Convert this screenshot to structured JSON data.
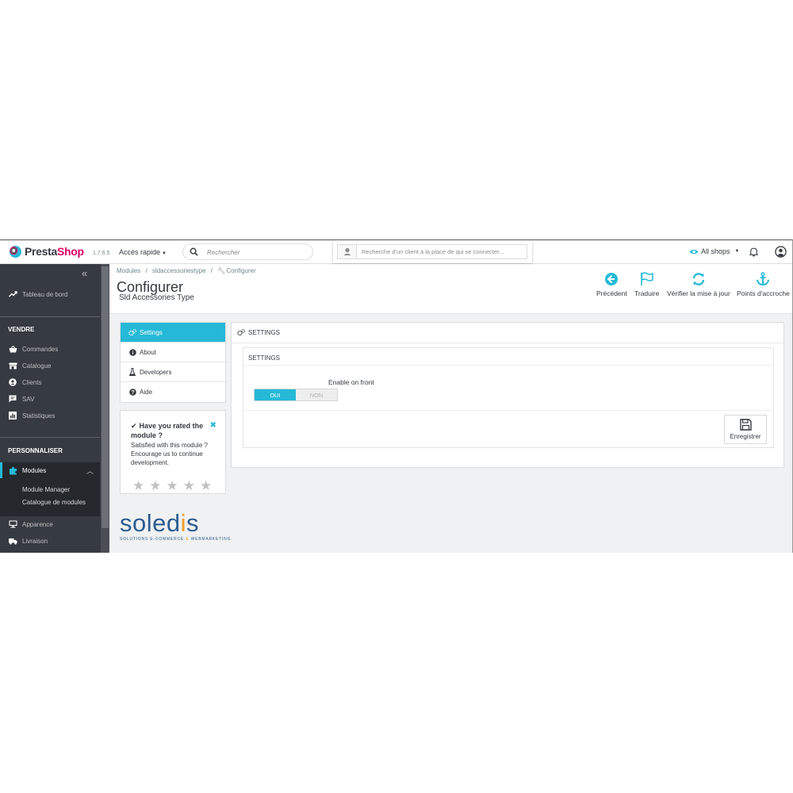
{
  "header": {
    "brand_name": "Presta",
    "brand_name_accent": "Shop",
    "version": "1.7.6.5",
    "quick_access": "Accès rapide",
    "search_placeholder": "Rechercher",
    "customer_placeholder": "Recherche d'un client à la place de qui se connecter...",
    "shops": "All shops"
  },
  "sidebar": {
    "collapse": "«",
    "dashboard": "Tableau de bord",
    "section_sell": "VENDRE",
    "sell_items": [
      "Commandes",
      "Catalogue",
      "Clients",
      "SAV",
      "Statistiques"
    ],
    "section_customize": "PERSONNALISER",
    "modules": "Modules",
    "modules_sub": [
      "Module Manager",
      "Catalogue de modules"
    ],
    "more_items": [
      "Apparence",
      "Livraison"
    ]
  },
  "page": {
    "breadcrumb": [
      "Modules",
      "/",
      "sldaccessoriestype",
      "/",
      "Configurer"
    ],
    "title": "Configurer",
    "subtitle": "Sld Accessories Type",
    "toolbar": [
      "Précédent",
      "Traduire",
      "Vérifier la mise à jour",
      "Points d'accroche"
    ]
  },
  "tabs": [
    "Settings",
    "About",
    "Developers",
    "Aide"
  ],
  "rating": {
    "title": "Have you rated the module ?",
    "close": "✖",
    "text": "Satisfied with this module ? Encourage us to continue development.",
    "stars": 5
  },
  "soledis": {
    "word_a": "soled",
    "word_b": "i",
    "word_c": "s",
    "tagline_a": "SOLUTIONS E-COMMERCE",
    "tagline_amp": "&",
    "tagline_b": "WEBMARKETING"
  },
  "settings": {
    "panel_title": "SETTINGS",
    "section_title": "SETTINGS",
    "field_label": "Enable on front",
    "on": "OUI",
    "off": "NON",
    "enabled": true,
    "save": "Enregistrer"
  },
  "colors": {
    "accent": "#25b9d7",
    "brand_pink": "#df0067",
    "sidebar_bg": "#363a41",
    "soledis_blue": "#2d5c8f",
    "soledis_orange": "#f39c24"
  },
  "icons": [
    "search-icon",
    "user-icon",
    "eye-icon",
    "bell-icon",
    "account-icon",
    "back-circle-icon",
    "flag-icon",
    "refresh-icon",
    "anchor-icon",
    "save-icon",
    "cogs-icon",
    "info-icon",
    "flask-icon",
    "question-icon",
    "check-icon",
    "star-icon"
  ]
}
